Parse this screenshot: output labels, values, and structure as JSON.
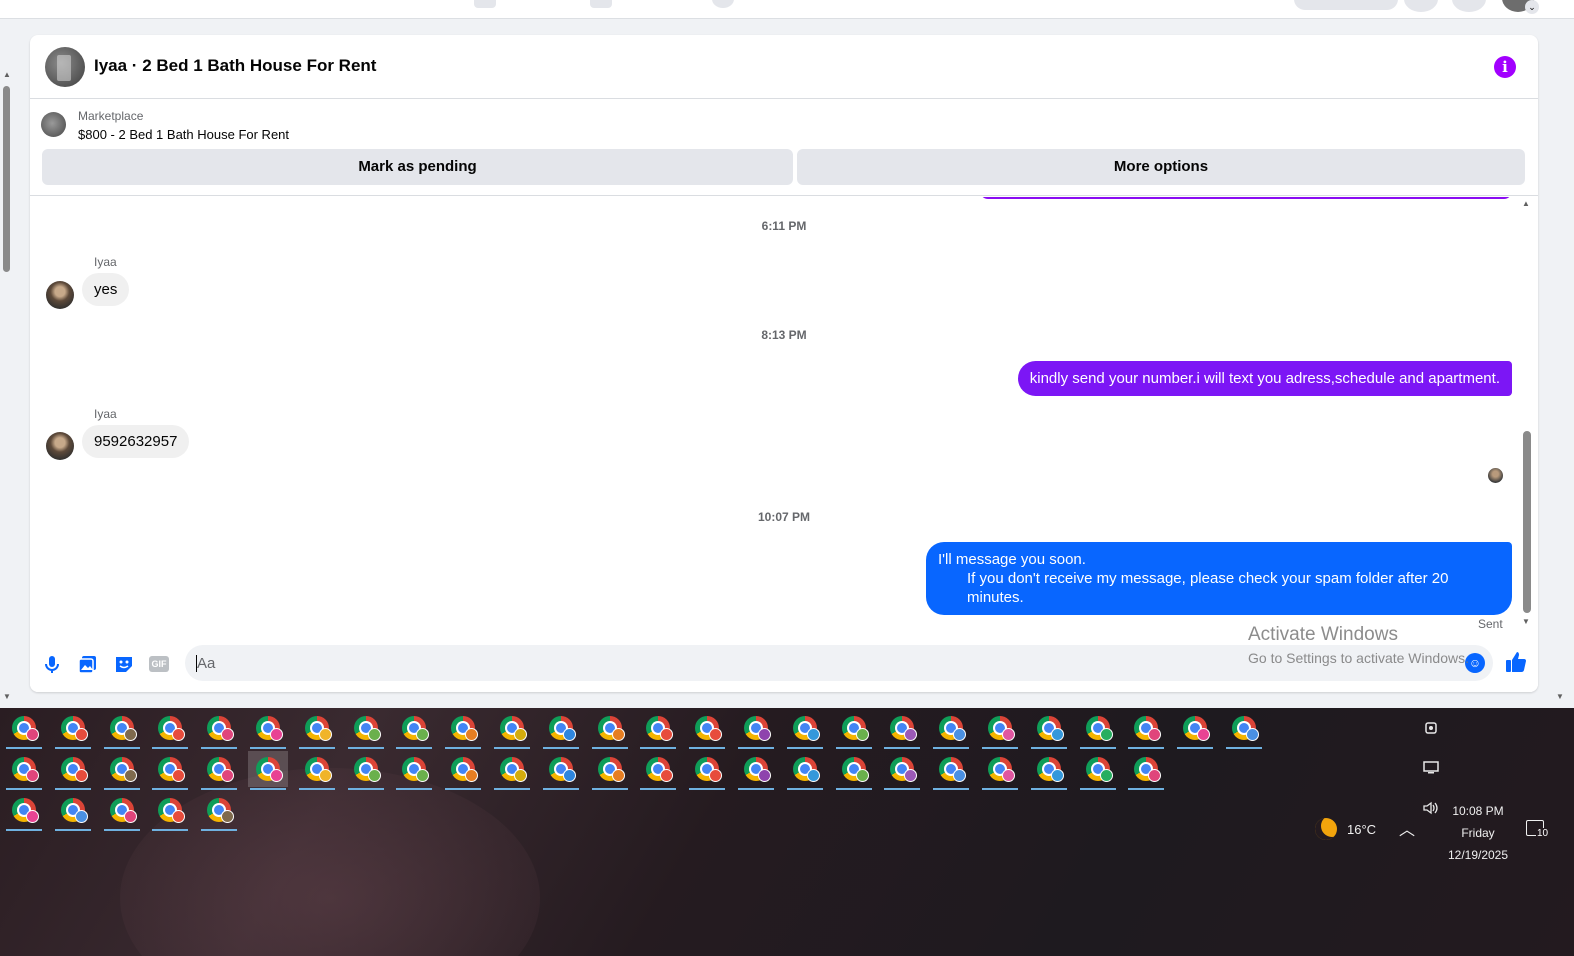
{
  "chat": {
    "title": "Iyaa · 2 Bed 1 Bath House For Rent",
    "info_icon": "info-icon"
  },
  "listing": {
    "label": "Marketplace",
    "text": "$800 - 2 Bed 1 Bath House For Rent",
    "mark_pending_label": "Mark as pending",
    "more_options_label": "More options"
  },
  "messages": {
    "ts1": "6:11 PM",
    "sender1": "Iyaa",
    "msg1": "yes",
    "ts2": "8:13 PM",
    "out1": "kindly send your number.i will text you adress,schedule and apartment.",
    "sender2": "Iyaa",
    "msg2": "9592632957",
    "ts3": "10:07 PM",
    "out2_line1": "I'll message you soon.",
    "out2_line2": "If you don't receive my message, please check your spam folder after 20 minutes.",
    "status": "Sent"
  },
  "composer": {
    "placeholder": "Aa",
    "gif_label": "GIF"
  },
  "watermark": {
    "line1": "Activate Windows",
    "line2": "Go to Settings to activate Windows."
  },
  "colors": {
    "accent_purple": "#7c16f5",
    "accent_blue": "#0866ff",
    "info_purple": "#a200ff"
  },
  "taskbar": {
    "app_icon": "chrome-profile-icon",
    "app_count": 55,
    "weather_temp": "16°C",
    "time": "10:08 PM",
    "day": "Friday",
    "date": "12/19/2025",
    "notification_count": "10"
  }
}
